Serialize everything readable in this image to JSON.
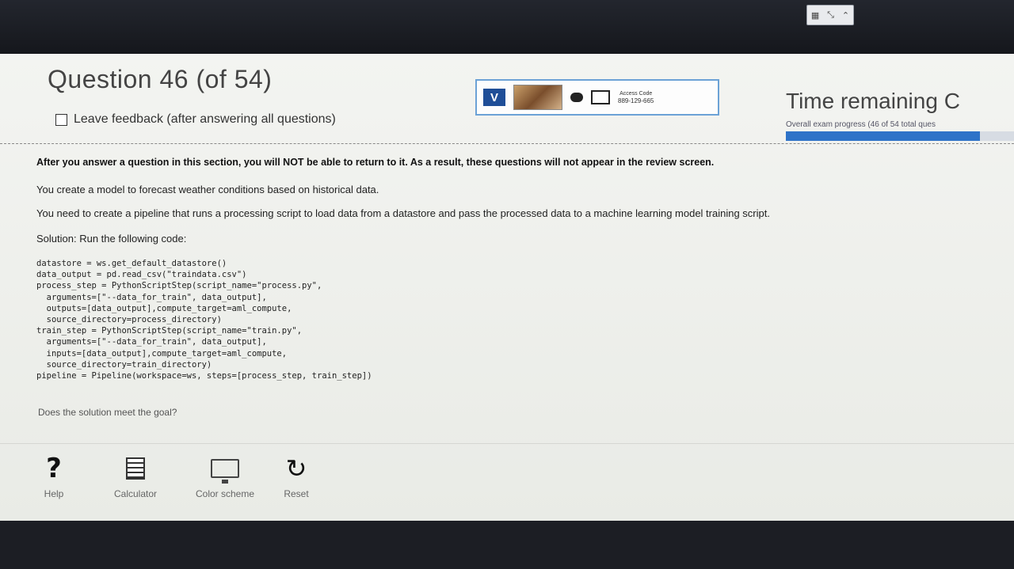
{
  "header": {
    "title": "Question 46 (of 54)",
    "feedback_label": "Leave feedback (after answering all questions)",
    "time_label": "Time remaining",
    "time_value": "C",
    "progress_text": "Overall exam progress (46 of 54 total ques",
    "progress_fraction": 0.85
  },
  "proctor": {
    "v_label": "V",
    "access_label": "Access Code",
    "access_code": "889-129-665"
  },
  "content": {
    "notice": "After you answer a question in this section, you will NOT be able to return to it. As a result, these questions will not appear in the review screen.",
    "paragraph1": "You create a model to forecast weather conditions based on historical data.",
    "paragraph2": "You need to create a pipeline that runs a processing script to load data from a datastore and pass the processed data to a machine learning model training script.",
    "solution_label": "Solution: Run the following code:",
    "code": "datastore = ws.get_default_datastore()\ndata_output = pd.read_csv(\"traindata.csv\")\nprocess_step = PythonScriptStep(script_name=\"process.py\",\n  arguments=[\"--data_for_train\", data_output],\n  outputs=[data_output],compute_target=aml_compute,\n  source_directory=process_directory)\ntrain_step = PythonScriptStep(script_name=\"train.py\",\n  arguments=[\"--data_for_train\", data_output],\n  inputs=[data_output],compute_target=aml_compute,\n  source_directory=train_directory)\npipeline = Pipeline(workspace=ws, steps=[process_step, train_step])",
    "question": "Does the solution meet the goal?"
  },
  "toolbar": {
    "help_label": "Help",
    "calculator_label": "Calculator",
    "color_label": "Color scheme",
    "reset_label": "Reset"
  }
}
